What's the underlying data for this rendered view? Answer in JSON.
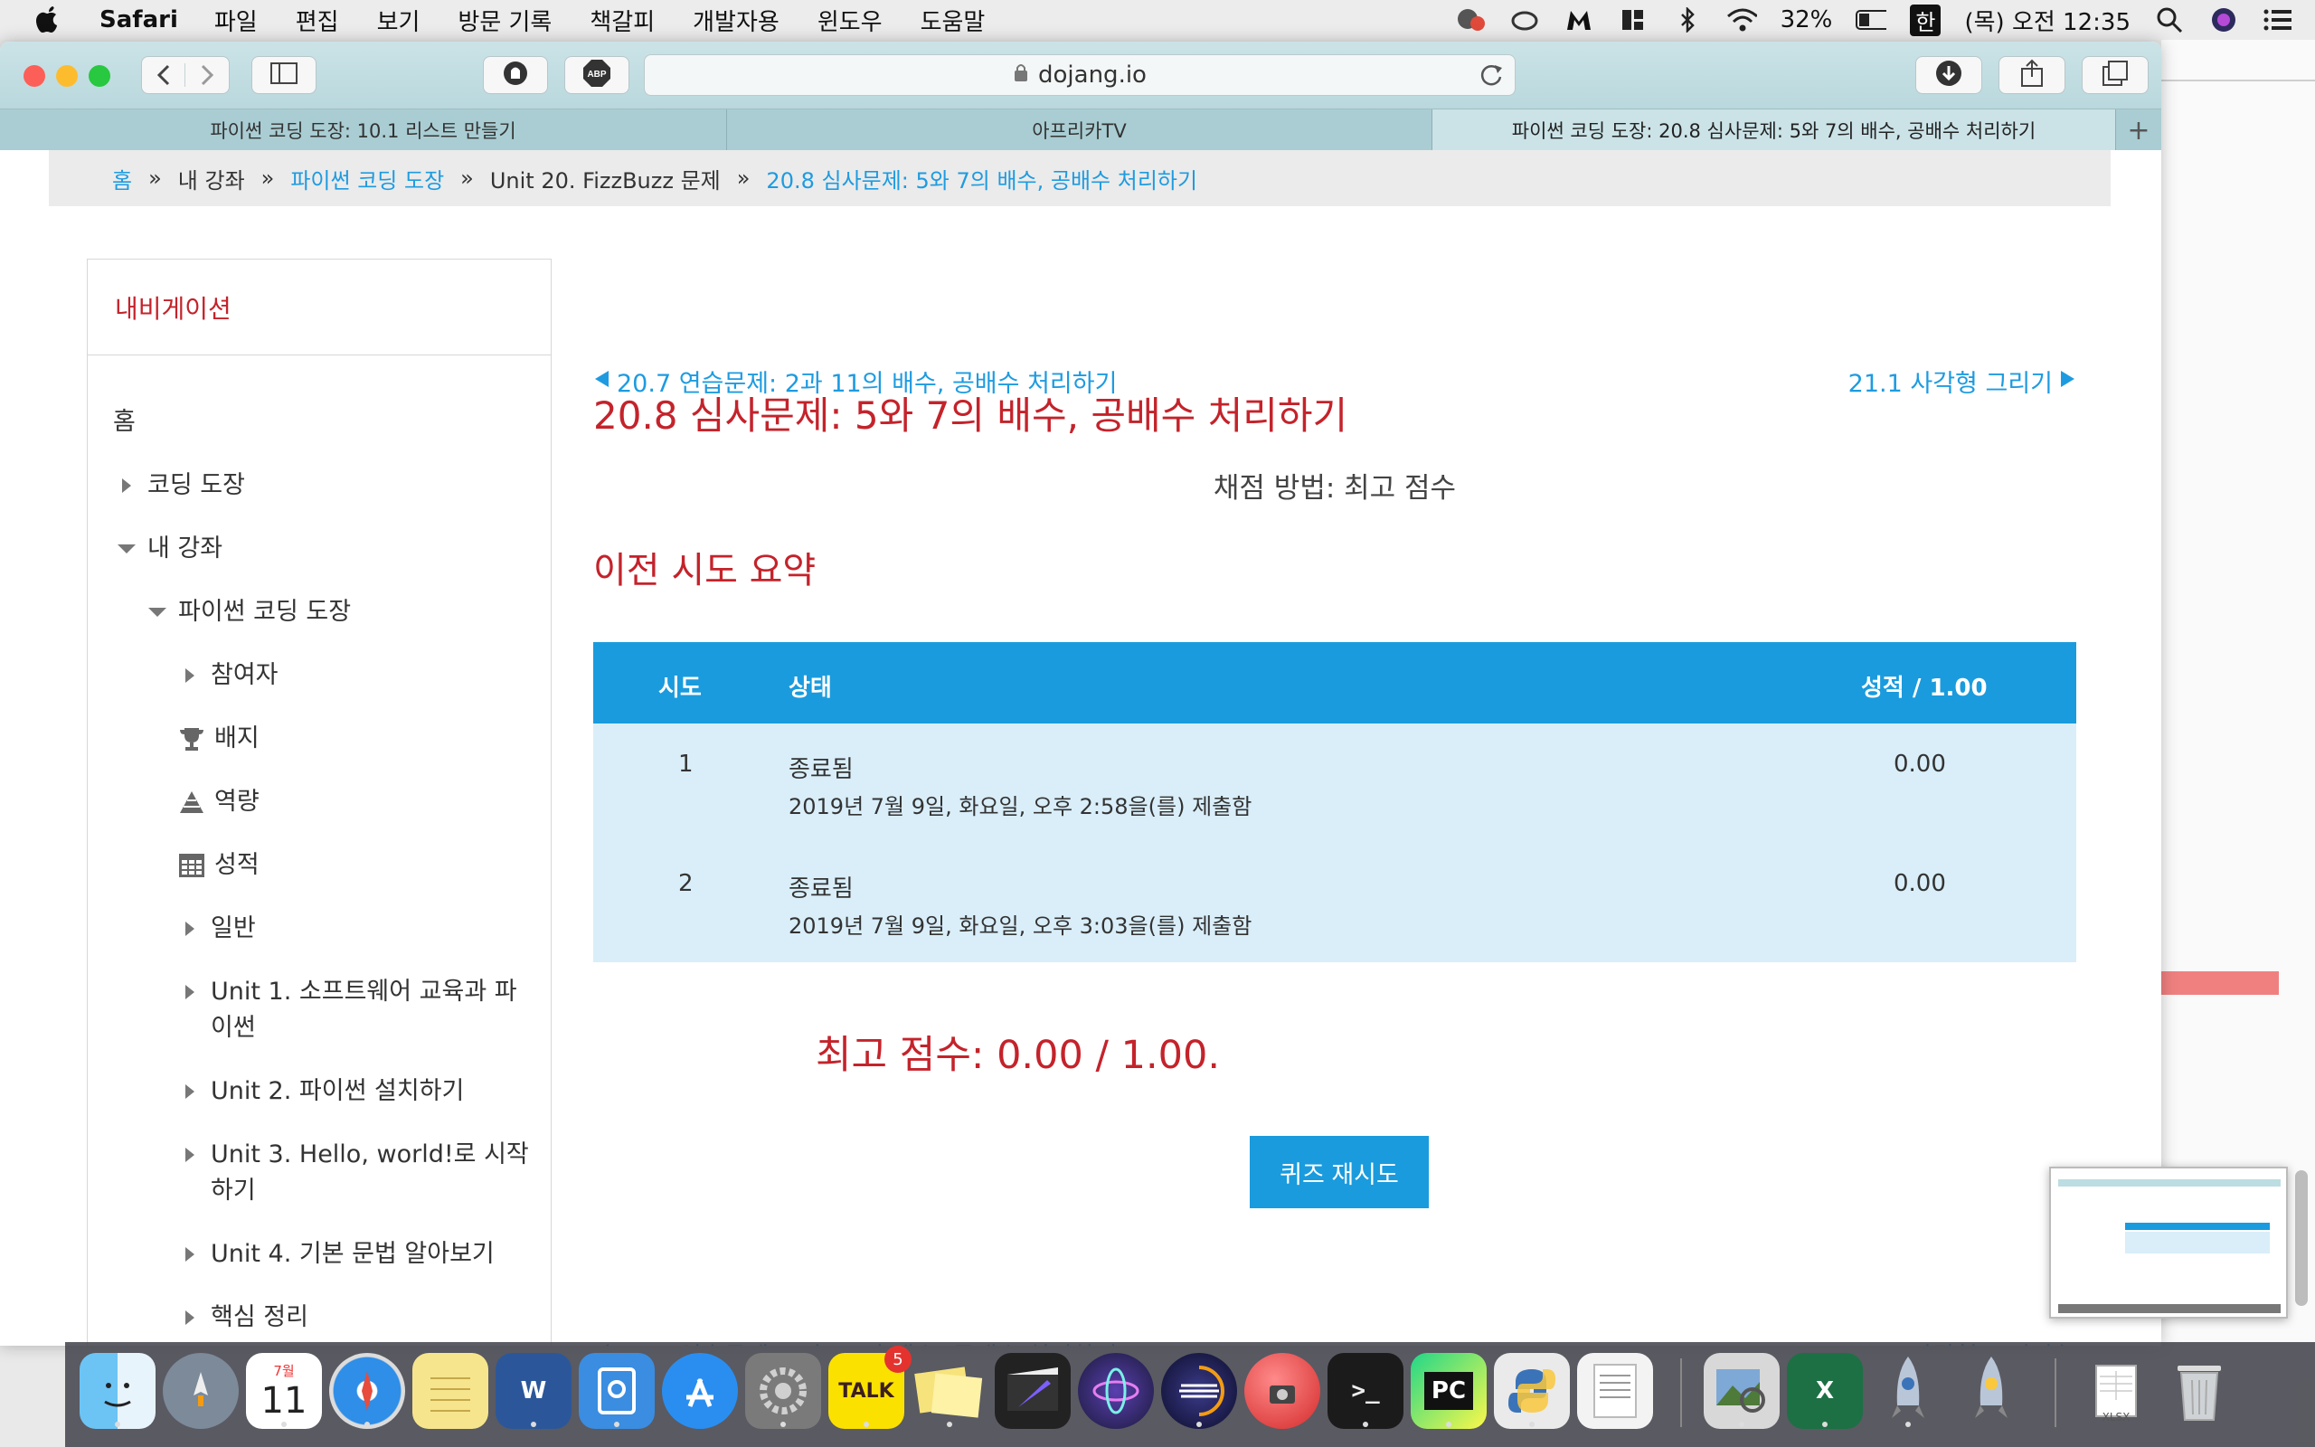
{
  "menubar": {
    "app": "Safari",
    "items": [
      "파일",
      "편집",
      "보기",
      "방문 기록",
      "책갈피",
      "개발자용",
      "윈도우",
      "도움말"
    ],
    "battery": "32%",
    "input_source": "한",
    "clock": "(목) 오전 12:35"
  },
  "browser": {
    "url": "dojang.io",
    "tabs": [
      {
        "title": "파이썬 코딩 도장: 10.1 리스트 만들기",
        "active": false
      },
      {
        "title": "아프리카TV",
        "active": false
      },
      {
        "title": "파이썬 코딩 도장: 20.8 심사문제: 5와 7의 배수, 공배수 처리하기",
        "active": true
      }
    ],
    "new_tab": "+"
  },
  "breadcrumb": {
    "home": "홈",
    "my_courses": "내 강좌",
    "course": "파이썬 코딩 도장",
    "unit": "Unit 20. FizzBuzz 문제",
    "current": "20.8 심사문제: 5와 7의 배수, 공배수 처리하기",
    "sep": "»"
  },
  "nav": {
    "heading": "내비게이션",
    "items": [
      {
        "label": "홈"
      },
      {
        "label": "코딩 도장"
      },
      {
        "label": "내 강좌"
      },
      {
        "label": "파이썬 코딩 도장"
      },
      {
        "label": "참여자"
      },
      {
        "label": "배지"
      },
      {
        "label": "역량"
      },
      {
        "label": "성적"
      },
      {
        "label": "일반"
      },
      {
        "label": "Unit 1. 소프트웨어 교육과 파",
        "label2": "이썬"
      },
      {
        "label": "Unit 2. 파이썬 설치하기"
      },
      {
        "label": "Unit 3. Hello, world!로 시작",
        "label2": "하기"
      },
      {
        "label": "Unit 4. 기본 문법 알아보기"
      },
      {
        "label": "핵심 정리"
      }
    ]
  },
  "main": {
    "prev_link": "20.7 연습문제: 2과 11의 배수, 공배수 처리하기",
    "next_link": "21.1 사각형 그리기",
    "title": "20.8 심사문제: 5와 7의 배수, 공배수 처리하기",
    "grading_method": "채점 방법: 최고 점수",
    "summary_heading": "이전 시도 요약",
    "table": {
      "headers": {
        "attempt": "시도",
        "status": "상태",
        "grade": "성적 / 1.00"
      },
      "rows": [
        {
          "attempt": "1",
          "status": "종료됨",
          "submitted": "2019년 7월 9일, 화요일, 오후 2:58을(를) 제출함",
          "grade": "0.00"
        },
        {
          "attempt": "2",
          "status": "종료됨",
          "submitted": "2019년 7월 9일, 화요일, 오후 3:03을(를) 제출함",
          "grade": "0.00"
        }
      ]
    },
    "best_score": "최고 점수: 0.00 / 1.00.",
    "retry_button": "퀴즈 재시도"
  },
  "dock": {
    "calendar_month": "7월",
    "calendar_day": "11",
    "talk_label": "TALK",
    "talk_badge": "5",
    "word_label": "W",
    "excel_label": "X",
    "pycharm_label": "PC",
    "terminal_label": ">_",
    "xlsx_label": "XLSX"
  },
  "colors": {
    "accent_blue": "#1a9bdd",
    "title_red": "#c4232b",
    "row_bg": "#d9eef9"
  }
}
